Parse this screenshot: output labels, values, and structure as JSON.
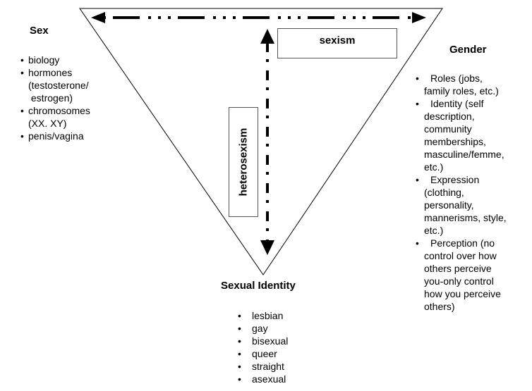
{
  "diagram": {
    "sex": {
      "title": "Sex",
      "items": [
        {
          "lines": [
            "biology"
          ]
        },
        {
          "lines": [
            "hormones",
            "(testosterone/",
            " estrogen)"
          ]
        },
        {
          "lines": [
            "chromosomes",
            "(XX. XY)"
          ]
        },
        {
          "lines": [
            "penis/vagina"
          ]
        }
      ]
    },
    "gender": {
      "title": "Gender",
      "items": [
        {
          "lines": [
            "Roles (jobs,",
            "family roles, etc.)"
          ]
        },
        {
          "lines": [
            "Identity (self",
            "description,",
            "community",
            "memberships,",
            "masculine/femme,",
            "etc.)"
          ]
        },
        {
          "lines": [
            "Expression",
            "(clothing,",
            "personality,",
            "mannerisms, style,",
            "etc.)"
          ]
        },
        {
          "lines": [
            "Perception (no",
            "control over how",
            "others perceive",
            "you-only control",
            "how you perceive",
            "others)"
          ]
        }
      ]
    },
    "sexual_identity": {
      "title": "Sexual Identity",
      "items": [
        {
          "lines": [
            "lesbian"
          ]
        },
        {
          "lines": [
            "gay"
          ]
        },
        {
          "lines": [
            "bisexual"
          ]
        },
        {
          "lines": [
            "queer"
          ]
        },
        {
          "lines": [
            "straight"
          ]
        },
        {
          "lines": [
            "asexual"
          ]
        }
      ]
    },
    "labels": {
      "sexism": "sexism",
      "heterosexism": "heterosexism"
    },
    "bullet_glyph": "•",
    "colors": {
      "line": "#000000",
      "box_border": "#555555",
      "background": "#ffffff"
    }
  }
}
